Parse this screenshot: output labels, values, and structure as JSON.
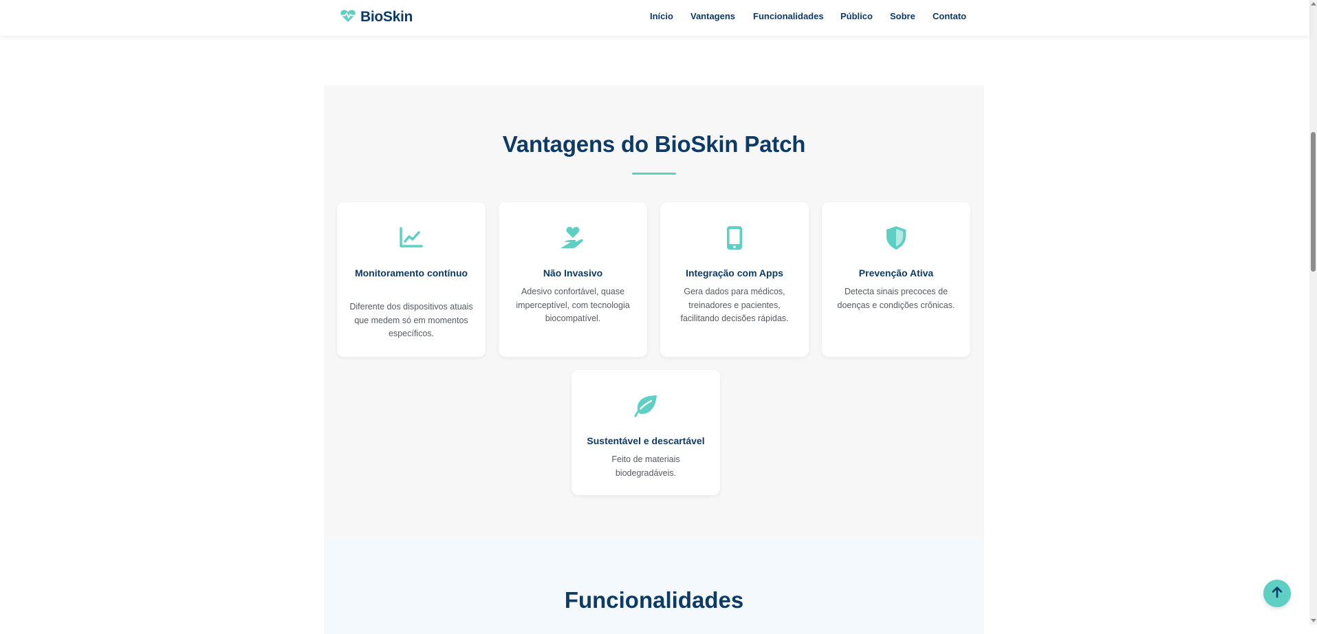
{
  "brand": {
    "name": "BioSkin",
    "icon": "heart-pulse-icon",
    "accent_color": "#5ecfc3",
    "primary_color": "#0d3a66"
  },
  "nav": {
    "items": [
      {
        "label": "Início"
      },
      {
        "label": "Vantagens"
      },
      {
        "label": "Funcionalidades"
      },
      {
        "label": "Público"
      },
      {
        "label": "Sobre"
      },
      {
        "label": "Contato"
      }
    ]
  },
  "vantagens": {
    "title": "Vantagens do BioSkin Patch",
    "cards": [
      {
        "icon": "chart-line-icon",
        "title": "Monitoramento contínuo",
        "description": "Diferente dos dispositivos atuais que medem só em momentos específicos."
      },
      {
        "icon": "hand-holding-heart-icon",
        "title": "Não Invasivo",
        "description": "Adesivo confortável, quase imperceptível, com tecnologia biocompatível."
      },
      {
        "icon": "mobile-phone-icon",
        "title": "Integração com Apps",
        "description": "Gera dados para médicos, treinadores e pacientes, facilitando decisões rápidas."
      },
      {
        "icon": "shield-icon",
        "title": "Prevenção Ativa",
        "description": "Detecta sinais precoces de doenças e condições crônicas."
      },
      {
        "icon": "leaf-icon",
        "title": "Sustentável e descartável",
        "description": "Feito de materiais biodegradáveis."
      }
    ]
  },
  "funcionalidades": {
    "title": "Funcionalidades"
  },
  "back_to_top": {
    "icon": "arrow-up-icon"
  }
}
